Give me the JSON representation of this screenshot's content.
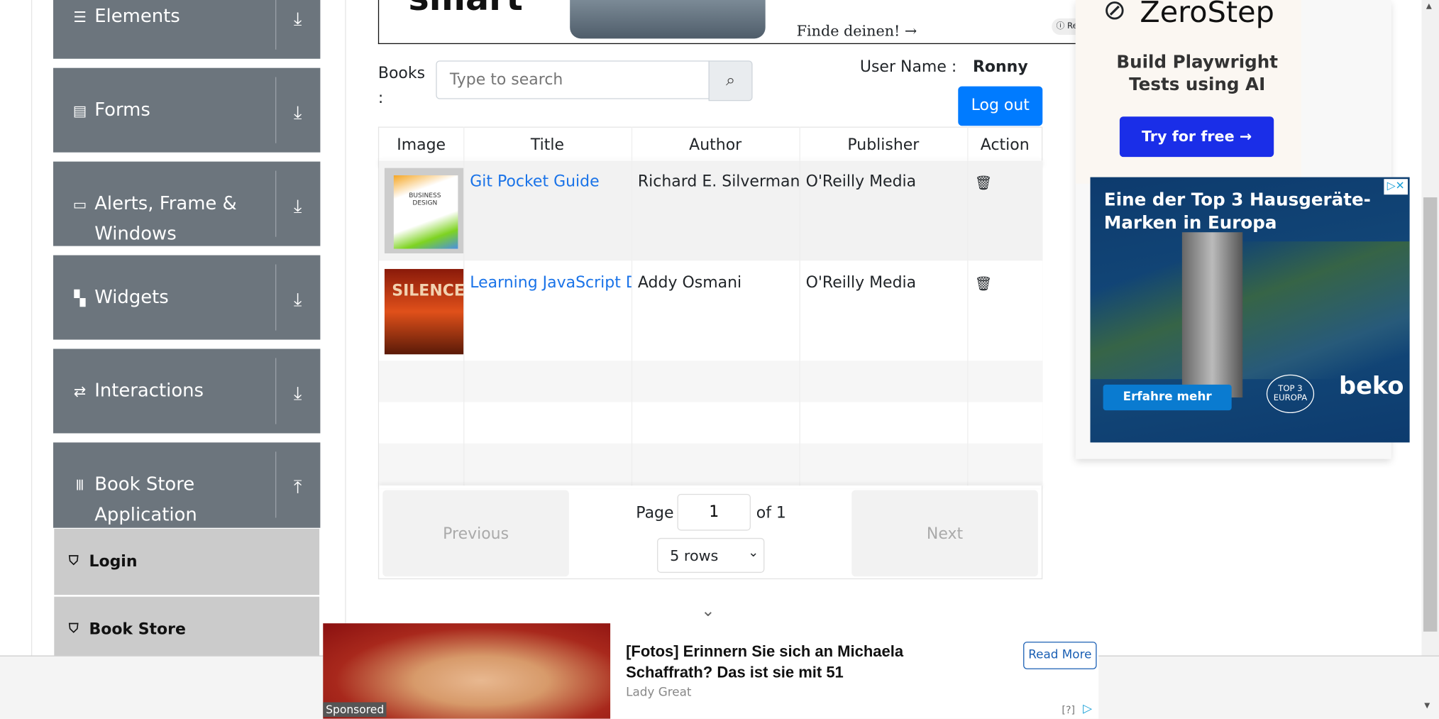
{
  "sidebar": {
    "groups": [
      {
        "label": "Elements",
        "icon": "list-icon",
        "arrow": "down"
      },
      {
        "label": "Forms",
        "icon": "form-icon",
        "arrow": "down"
      },
      {
        "label": "Alerts, Frame &",
        "label2": "Windows",
        "icon": "window-icon",
        "arrow": "down"
      },
      {
        "label": "Widgets",
        "icon": "widgets-icon",
        "arrow": "down"
      },
      {
        "label": "Interactions",
        "icon": "interactions-icon",
        "arrow": "down"
      },
      {
        "label": "Book Store",
        "label2": "Application",
        "icon": "books-icon",
        "arrow": "up"
      }
    ],
    "subitems": [
      {
        "label": "Login",
        "icon": "html5-icon"
      },
      {
        "label": "Book Store",
        "icon": "html5-icon"
      }
    ]
  },
  "top_ad": {
    "text": "Finde deinen! →",
    "brand": "smart"
  },
  "search": {
    "label": "Books",
    "label_colon": ":",
    "placeholder": "Type to search",
    "value": ""
  },
  "user": {
    "label": "User Name :",
    "name": "Ronny",
    "logout_label": "Log out"
  },
  "table": {
    "headers": [
      "Image",
      "Title",
      "Author",
      "Publisher",
      "Action"
    ],
    "rows": [
      {
        "title": "Git Pocket Guide",
        "author": "Richard E. Silverman",
        "publisher": "O'Reilly Media",
        "cover_text": "BUSINESS DESIGN"
      },
      {
        "title": "Learning JavaScript Design Patterns",
        "author": "Addy Osmani",
        "publisher": "O'Reilly Media",
        "cover_text": "SILENCE"
      }
    ]
  },
  "pagination": {
    "previous": "Previous",
    "next": "Next",
    "page_label": "Page",
    "page": "1",
    "of_label": "of 1",
    "rows_option": "5 rows"
  },
  "right_ad_1": {
    "brand": "ZeroStep",
    "line1": "Build Playwright",
    "line2": "Tests using AI",
    "cta": "Try for free →"
  },
  "right_ad_2": {
    "headline1": "Eine der Top 3 Hausgeräte-",
    "headline2": "Marken in Europa",
    "cta": "Erfahre mehr",
    "brand": "beko",
    "badge": "TOP 3 EUROPA"
  },
  "bottom_ad": {
    "sponsored": "Sponsored",
    "headline1": "[Fotos] Erinnern Sie sich an Michaela",
    "headline2": "Schaffrath? Das ist sie mit 51",
    "source": "Lady Great",
    "cta": "Read More",
    "help": "[?]"
  },
  "colors": {
    "sidebar_group": "#6c757d",
    "subitem": "#cbcbcb",
    "primary": "#007bff",
    "link": "#1a73e8",
    "zerostep_cta": "#1a2ee8",
    "beko_bg": "#0d3b6e"
  }
}
